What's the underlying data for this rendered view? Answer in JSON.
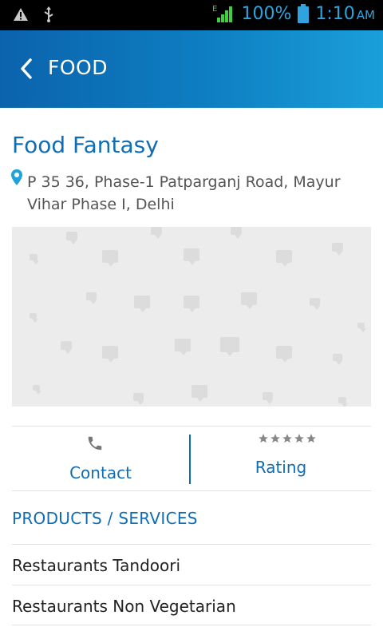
{
  "status_bar": {
    "network_type": "E",
    "battery": "100%",
    "time": "1:10",
    "ampm": "AM",
    "icons": [
      "warning-icon",
      "usb-icon",
      "signal-icon",
      "battery-icon"
    ]
  },
  "app_bar": {
    "title": "FOOD",
    "back_icon": "chevron-left-icon"
  },
  "business": {
    "name": "Food Fantasy",
    "address": "P 35 36, Phase-1 Patparganj Road, Mayur Vihar Phase I, Delhi"
  },
  "actions": {
    "contact_label": "Contact",
    "rating_label": "Rating",
    "rating_stars": 5
  },
  "products": {
    "title": "PRODUCTS / SERVICES",
    "items": [
      "Restaurants Tandoori",
      "Restaurants Non Vegetarian"
    ]
  },
  "colors": {
    "accent": "#0f6db6",
    "status_text": "#2ea3dd"
  }
}
